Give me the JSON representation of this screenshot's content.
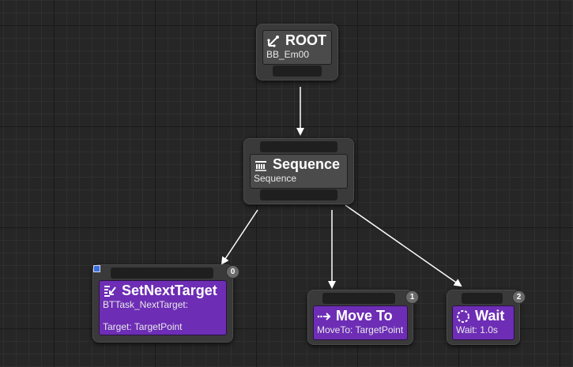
{
  "nodes": {
    "root": {
      "title": "ROOT",
      "subtitle": "BB_Em00",
      "icon": "root-icon"
    },
    "sequence": {
      "title": "Sequence",
      "subtitle": "Sequence",
      "icon": "sequence-icon"
    },
    "set_next_target": {
      "title": "SetNextTarget",
      "line1": "BTTask_NextTarget:",
      "line2": "Target: TargetPoint",
      "order": "0",
      "icon": "set-target-icon"
    },
    "move_to": {
      "title": "Move To",
      "subtitle": "MoveTo: TargetPoint",
      "order": "1",
      "icon": "move-to-icon"
    },
    "wait": {
      "title": "Wait",
      "subtitle": "Wait: 1.0s",
      "order": "2",
      "icon": "wait-icon"
    }
  },
  "colors": {
    "background": "#262626",
    "node": "#3a3a3a",
    "composite_body": "#4b4b4b",
    "task_body": "#6d2db5",
    "wire": "#ffffff"
  }
}
